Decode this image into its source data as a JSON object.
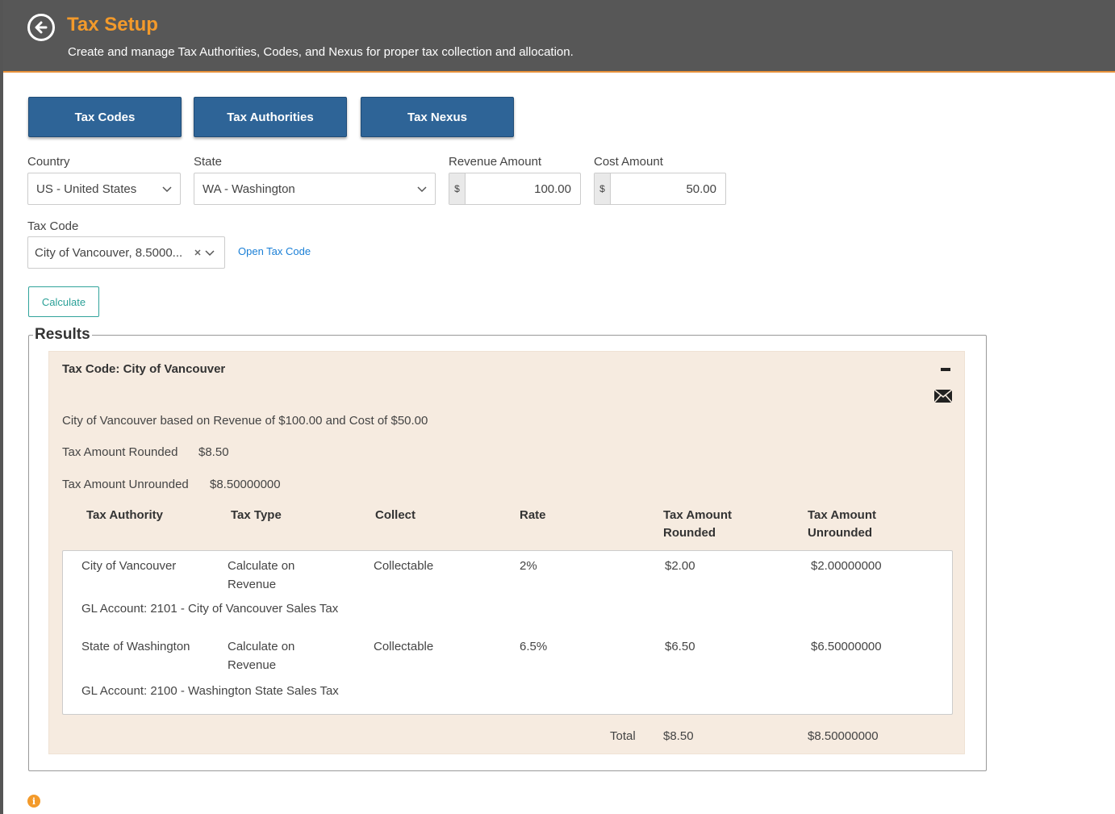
{
  "header": {
    "title": "Tax Setup",
    "subtitle": "Create and manage Tax Authorities, Codes, and Nexus for proper tax collection and allocation.",
    "back_icon": "arrow-left-circle-icon"
  },
  "tabs": [
    {
      "label": "Tax Codes"
    },
    {
      "label": "Tax Authorities"
    },
    {
      "label": "Tax Nexus"
    }
  ],
  "form": {
    "country": {
      "label": "Country",
      "value": "US - United States"
    },
    "state": {
      "label": "State",
      "value": "WA - Washington"
    },
    "revenue": {
      "label": "Revenue Amount",
      "currency": "$",
      "value": "100.00"
    },
    "cost": {
      "label": "Cost Amount",
      "currency": "$",
      "value": "50.00"
    },
    "tax_code": {
      "label": "Tax Code",
      "value": "City of Vancouver, 8.5000..."
    },
    "open_tax_code": "Open Tax Code",
    "calculate": "Calculate"
  },
  "results": {
    "legend": "Results",
    "tax_code_title": "Tax Code: City of Vancouver",
    "summary": "City of Vancouver based on Revenue of $100.00 and Cost of $50.00",
    "rounded_label": "Tax Amount Rounded",
    "rounded_value": "$8.50",
    "unrounded_label": "Tax Amount Unrounded",
    "unrounded_value": "$8.50000000",
    "columns": [
      "Tax Authority",
      "Tax Type",
      "Collect",
      "Rate",
      "Tax Amount Rounded",
      "Tax Amount Unrounded"
    ],
    "rows": [
      {
        "authority": "City of Vancouver",
        "type": "Calculate on Revenue",
        "collect": "Collectable",
        "rate": "2%",
        "rounded": "$2.00",
        "unrounded": "$2.00000000",
        "gl": "GL Account: 2101 - City of Vancouver Sales Tax"
      },
      {
        "authority": "State of Washington",
        "type": "Calculate on Revenue",
        "collect": "Collectable",
        "rate": "6.5%",
        "rounded": "$6.50",
        "unrounded": "$6.50000000",
        "gl": "GL Account: 2100 - Washington State Sales Tax"
      }
    ],
    "total_label": "Total",
    "total_rounded": "$8.50",
    "total_unrounded": "$8.50000000"
  },
  "colors": {
    "accent": "#f39a2b",
    "tab_blue": "#2e6497",
    "header_bg": "#575757",
    "panel_bg": "#f6ebe0",
    "teal": "#2aa097"
  }
}
